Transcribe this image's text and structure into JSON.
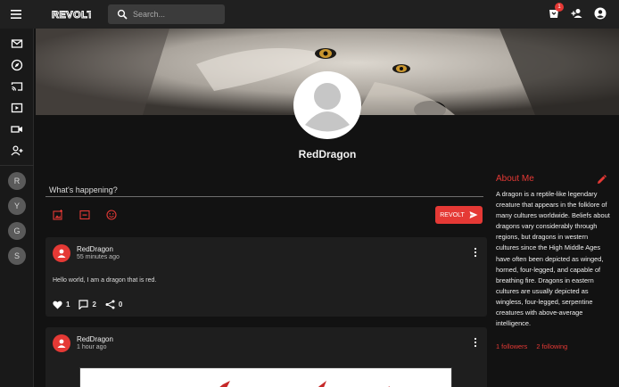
{
  "app": {
    "logo_text": "REVOLT"
  },
  "search": {
    "placeholder": "Search..."
  },
  "notifications": {
    "count": "1"
  },
  "servers": [
    "R",
    "Y",
    "G",
    "S"
  ],
  "profile": {
    "username": "RedDragon"
  },
  "composer": {
    "placeholder": "What's happening?",
    "submit_label": "REVOLT"
  },
  "posts": [
    {
      "author": "RedDragon",
      "time": "55 minutes ago",
      "text": "Hello world, I am a dragon that is red.",
      "likes": "1",
      "comments": "2",
      "shares": "0"
    },
    {
      "author": "RedDragon",
      "time": "1 hour ago"
    }
  ],
  "about": {
    "title": "About Me",
    "text": "A dragon is a reptile-like legendary creature that appears in the folklore of many cultures worldwide. Beliefs about dragons vary considerably through regions, but dragons in western cultures since the High Middle Ages have often been depicted as winged, horned, four-legged, and capable of breathing fire. Dragons in eastern cultures are usually depicted as wingless, four-legged, serpentine creatures with above-average intelligence.",
    "followers": "1 followers",
    "following": "2 following"
  },
  "colors": {
    "accent": "#e53935",
    "background": "#121212",
    "card": "#1e1e1e"
  }
}
